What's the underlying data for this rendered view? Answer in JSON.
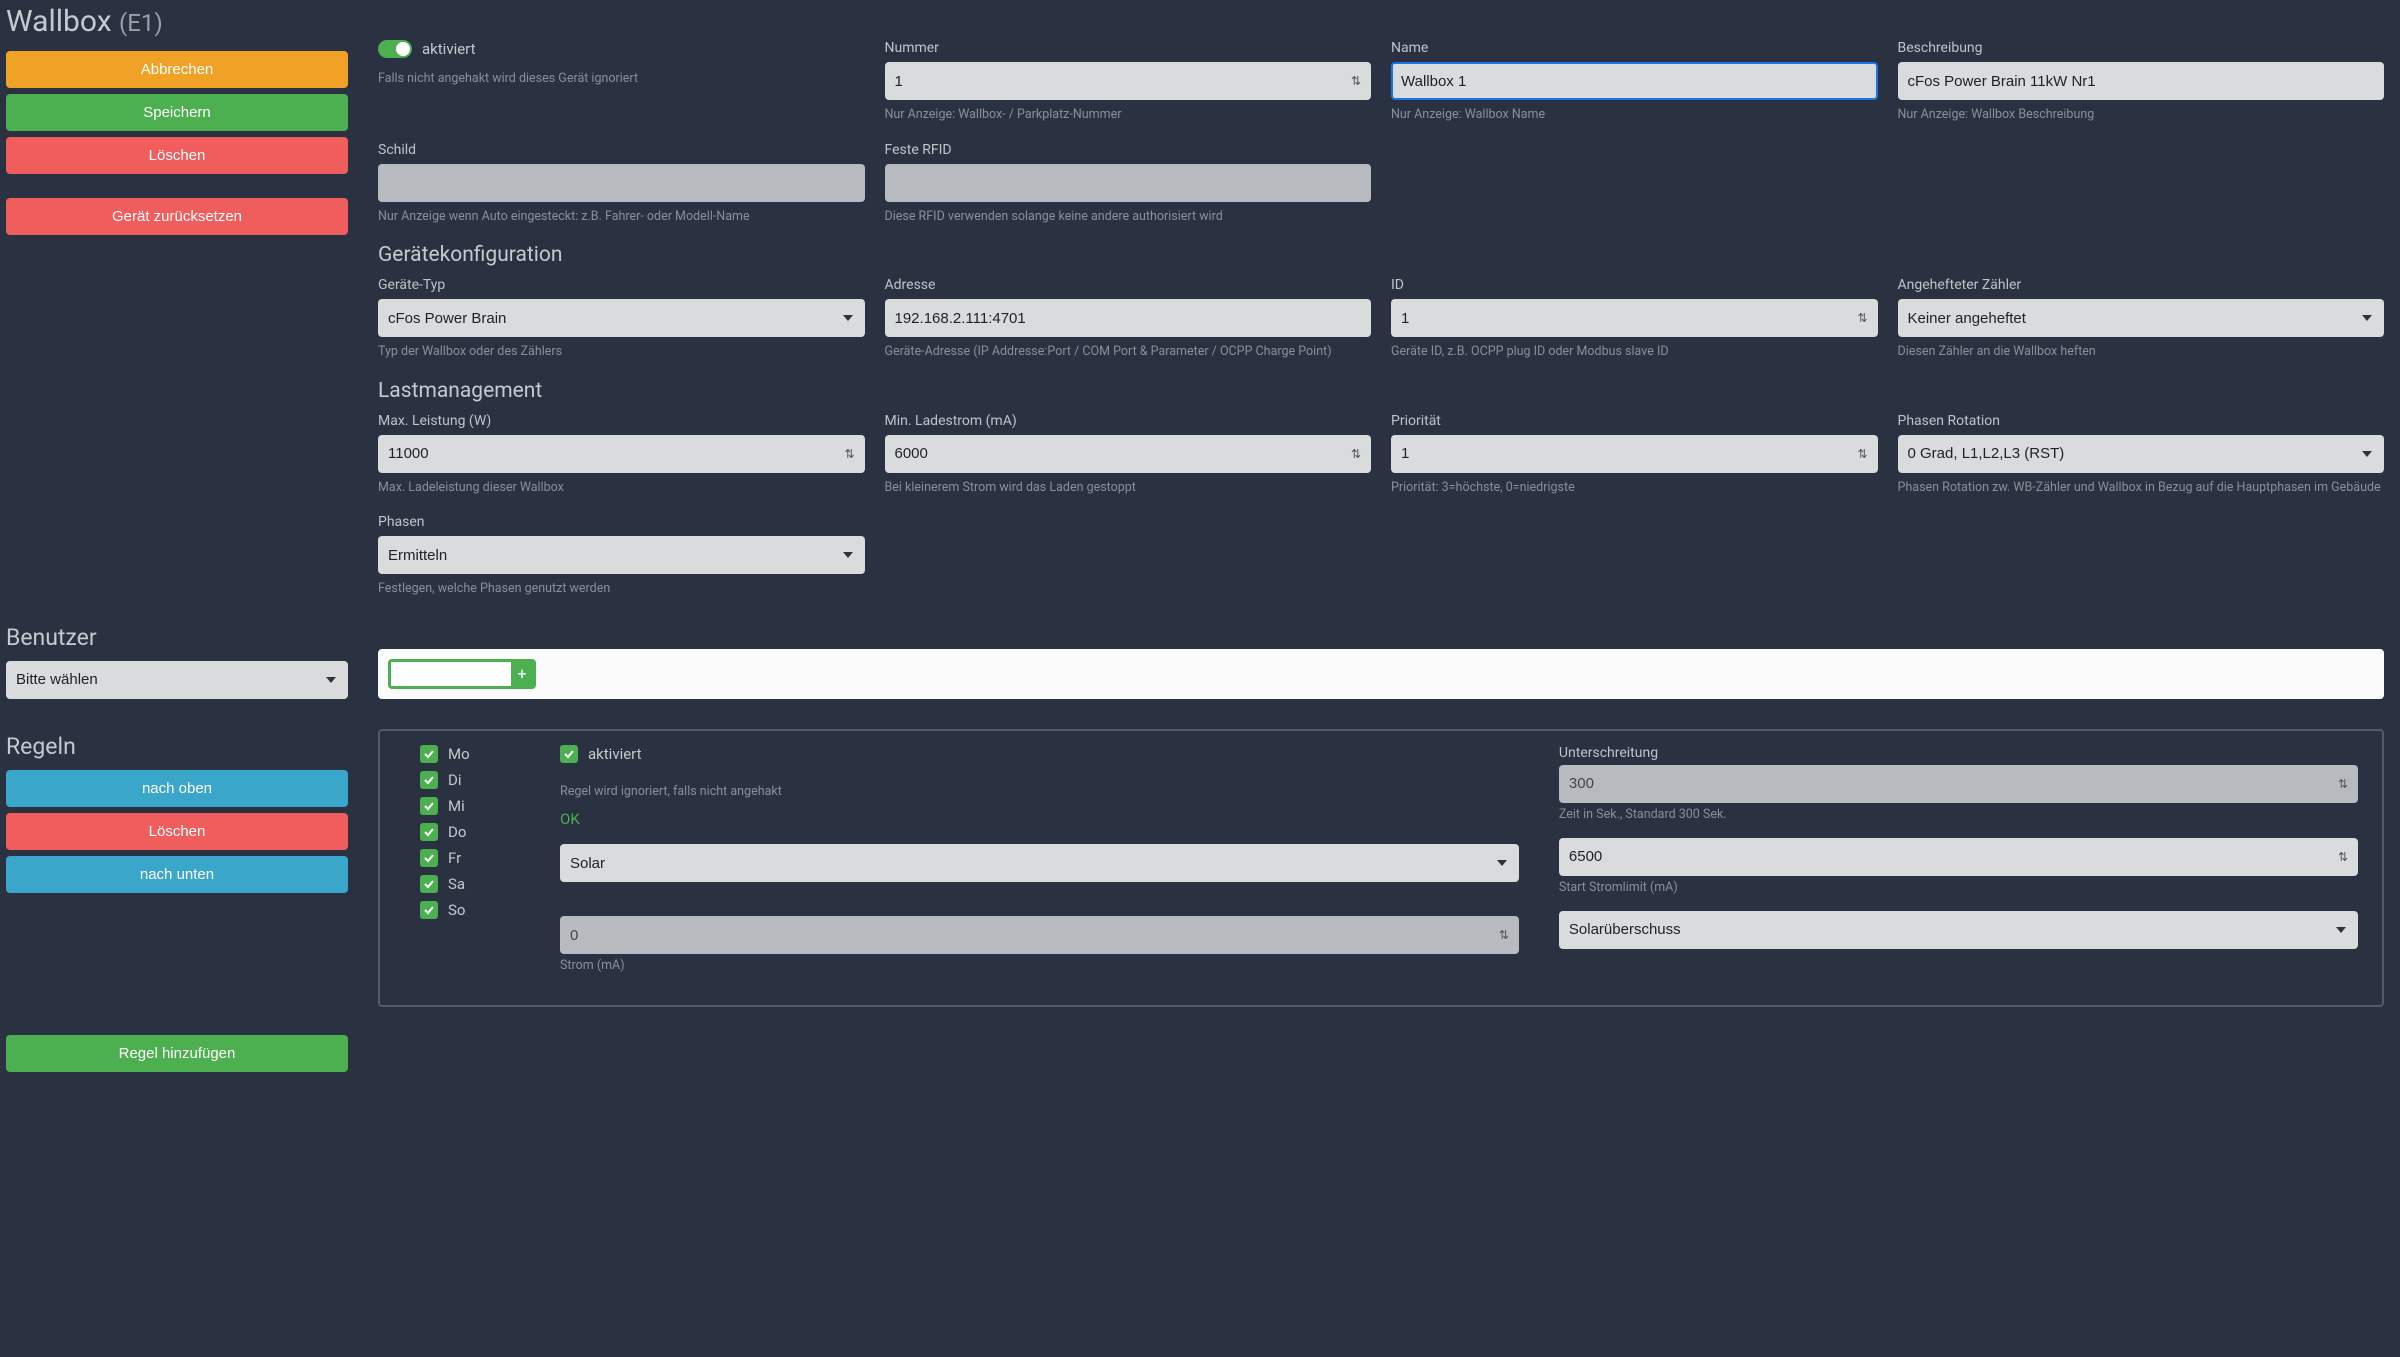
{
  "header": {
    "title": "Wallbox",
    "title_suffix": "(E1)"
  },
  "left_actions": {
    "cancel": "Abbrechen",
    "save": "Speichern",
    "delete": "Löschen",
    "reset_device": "Gerät zurücksetzen"
  },
  "activation": {
    "label": "aktiviert",
    "hint": "Falls nicht angehakt wird dieses Gerät ignoriert"
  },
  "fields": {
    "number": {
      "label": "Nummer",
      "value": "1",
      "hint": "Nur Anzeige: Wallbox- / Parkplatz-Nummer"
    },
    "name": {
      "label": "Name",
      "value": "Wallbox 1",
      "hint": "Nur Anzeige: Wallbox Name"
    },
    "desc": {
      "label": "Beschreibung",
      "value": "cFos Power Brain 11kW Nr1",
      "hint": "Nur Anzeige: Wallbox Beschreibung"
    },
    "schild": {
      "label": "Schild",
      "value": "",
      "hint": "Nur Anzeige wenn Auto eingesteckt: z.B. Fahrer- oder Modell-Name"
    },
    "rfid": {
      "label": "Feste RFID",
      "value": "",
      "hint": "Diese RFID verwenden solange keine andere authorisiert wird"
    }
  },
  "device_config": {
    "title": "Gerätekonfiguration",
    "type": {
      "label": "Geräte-Typ",
      "value": "cFos Power Brain",
      "hint": "Typ der Wallbox oder des Zählers"
    },
    "addr": {
      "label": "Adresse",
      "value": "192.168.2.111:4701",
      "hint": "Geräte-Adresse (IP Addresse:Port / COM Port & Parameter / OCPP Charge Point)"
    },
    "id": {
      "label": "ID",
      "value": "1",
      "hint": "Geräte ID, z.B. OCPP plug ID oder Modbus slave ID"
    },
    "meter": {
      "label": "Angehefteter Zähler",
      "value": "Keiner angeheftet",
      "hint": "Diesen Zähler an die Wallbox heften"
    }
  },
  "load_mgmt": {
    "title": "Lastmanagement",
    "maxw": {
      "label": "Max. Leistung (W)",
      "value": "11000",
      "hint": "Max. Ladeleistung dieser Wallbox"
    },
    "minc": {
      "label": "Min. Ladestrom (mA)",
      "value": "6000",
      "hint": "Bei kleinerem Strom wird das Laden gestoppt"
    },
    "prio": {
      "label": "Priorität",
      "value": "1",
      "hint": "Priorität: 3=höchste, 0=niedrigste"
    },
    "rot": {
      "label": "Phasen Rotation",
      "value": "0 Grad, L1,L2,L3 (RST)",
      "hint": "Phasen Rotation zw. WB-Zähler und Wallbox in Bezug auf die Hauptphasen im Gebäude"
    },
    "phasen": {
      "label": "Phasen",
      "value": "Ermitteln",
      "hint": "Festlegen, welche Phasen genutzt werden"
    }
  },
  "users": {
    "title": "Benutzer",
    "select_placeholder": "Bitte wählen"
  },
  "rules": {
    "title": "Regeln",
    "up": "nach oben",
    "delete": "Löschen",
    "down": "nach unten",
    "add": "Regel hinzufügen",
    "days": [
      "Mo",
      "Di",
      "Mi",
      "Do",
      "Fr",
      "Sa",
      "So"
    ],
    "activated_label": "aktiviert",
    "activated_hint": "Regel wird ignoriert, falls nicht angehakt",
    "ok": "OK",
    "type_value": "Solar",
    "current_value": "0",
    "current_label": "Strom (mA)",
    "under_label": "Unterschreitung",
    "under_value": "300",
    "under_hint": "Zeit in Sek., Standard 300 Sek.",
    "start_value": "6500",
    "start_hint": "Start Stromlimit (mA)",
    "mode_value": "Solarüberschuss"
  }
}
